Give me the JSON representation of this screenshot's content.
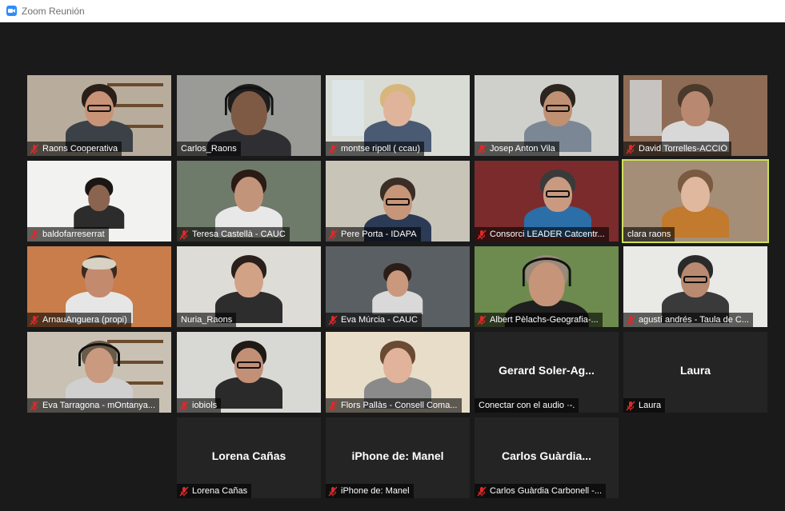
{
  "window": {
    "title": "Zoom Reunión",
    "icon": "zoom-camera-icon"
  },
  "colors": {
    "accent_active": "#cde05c",
    "mute_icon": "#e02828",
    "brand": "#2D8CFF"
  },
  "tiles": [
    {
      "name": "Raons Cooperativa",
      "muted": true,
      "video": true
    },
    {
      "name": "Carlos_Raons",
      "muted": false,
      "video": true
    },
    {
      "name": "montse ripoll ( ccau)",
      "muted": true,
      "video": true
    },
    {
      "name": "Josep Anton Vila",
      "muted": true,
      "video": true
    },
    {
      "name": "David Torrelles-ACCIÓ",
      "muted": true,
      "video": true
    },
    {
      "name": "baldofarreserrat",
      "muted": true,
      "video": true
    },
    {
      "name": "Teresa Castellà - CAUC",
      "muted": true,
      "video": true
    },
    {
      "name": "Pere Porta - IDAPA",
      "muted": true,
      "video": true
    },
    {
      "name": "Consorci LEADER Catcentr...",
      "muted": true,
      "video": true
    },
    {
      "name": "clara raons",
      "muted": false,
      "video": true,
      "active_speaker": true
    },
    {
      "name": "ArnauAnguera (propi)",
      "muted": true,
      "video": true
    },
    {
      "name": "Nuria_Raons",
      "muted": false,
      "video": true
    },
    {
      "name": "Eva Múrcia - CAUC",
      "muted": true,
      "video": true
    },
    {
      "name": "Albert Pèlachs-Geografia-...",
      "muted": true,
      "video": true
    },
    {
      "name": "agustí andrés - Taula de C...",
      "muted": true,
      "video": true
    },
    {
      "name": "Eva Tarragona - mOntanya...",
      "muted": true,
      "video": true
    },
    {
      "name": "iobiols",
      "muted": true,
      "video": true
    },
    {
      "name": "Flors Pallàs - Consell Coma...",
      "muted": true,
      "video": true
    },
    {
      "name": "Conectar con el audio ·-.",
      "muted": false,
      "video": false,
      "display_name": "Gerard  Soler-Ag..."
    },
    {
      "name": "Laura",
      "muted": true,
      "video": false,
      "display_name": "Laura"
    },
    {
      "name": "Lorena Cañas",
      "muted": true,
      "video": false,
      "display_name": "Lorena Cañas"
    },
    {
      "name": "iPhone de: Manel",
      "muted": true,
      "video": false,
      "display_name": "iPhone de: Manel"
    },
    {
      "name": "Carlos Guàrdia Carbonell -...",
      "muted": true,
      "video": false,
      "display_name": "Carlos  Guàrdia..."
    }
  ]
}
